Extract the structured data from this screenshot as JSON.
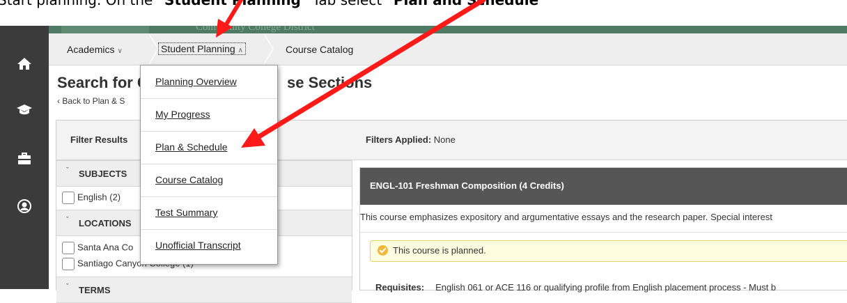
{
  "instruction": {
    "text_before": "Start planning.  On the “",
    "bold1": "Student Planning",
    "text_mid": "” Tab select “",
    "bold2": "Plan and Schedule",
    "text_after": "”"
  },
  "header": {
    "org_name": "Community College District"
  },
  "nav_rail": {
    "icons": [
      "home-icon",
      "graduation-cap-icon",
      "briefcase-icon",
      "user-icon"
    ]
  },
  "breadcrumb": {
    "items": [
      {
        "label": "Academics",
        "chevron": "∨"
      },
      {
        "label": "Student Planning",
        "chevron": "∧"
      },
      {
        "label": "Course Catalog"
      }
    ]
  },
  "page": {
    "title_start": "Search for C",
    "title_end": "se Sections",
    "back_link": "‹ Back to Plan & S"
  },
  "menu": {
    "items": [
      "Planning Overview",
      "My Progress",
      "Plan & Schedule",
      "Course Catalog",
      "Test Summary",
      "Unofficial Transcript"
    ]
  },
  "filter": {
    "header": "Filter Results",
    "groups": [
      {
        "label": "SUBJECTS",
        "caret": "ˇ",
        "options": [
          "English (2)"
        ]
      },
      {
        "label": "LOCATIONS",
        "caret": "ˇ",
        "options": [
          "Santa Ana Co",
          "Santiago Canyon College (1)"
        ]
      },
      {
        "label": "TERMS",
        "caret": "ˇ"
      }
    ]
  },
  "results": {
    "filters_label": "Filters Applied:",
    "filters_value": "None",
    "course": {
      "title": "ENGL-101 Freshman Composition (4 Credits)",
      "description": "This course emphasizes expository and argumentative essays and the research paper. Special interest",
      "planned_notice": "This course is planned.",
      "requisites_label": "Requisites:",
      "requisites_value": "English 061 or ACE 116 or qualifying profile from English placement process - Must b"
    }
  },
  "colors": {
    "rail": "#3b3b3b",
    "banner": "#4f7a64",
    "course_header": "#565656",
    "notice_bg": "#fffde0",
    "check": "#f0b93c",
    "arrow": "#ff1a1a"
  }
}
